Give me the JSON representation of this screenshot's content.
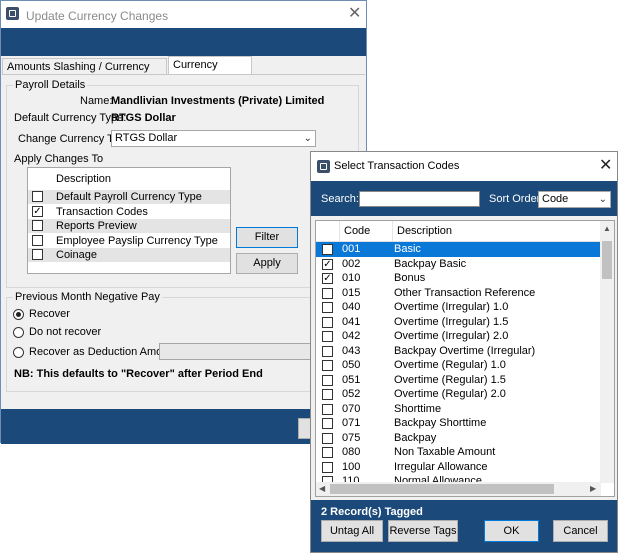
{
  "main_window": {
    "title": "Update Currency Changes",
    "tabs": [
      "Amounts Slashing / Currency Rebasing",
      "Currency Changes"
    ],
    "payroll_details": {
      "group_label": "Payroll Details",
      "name_label": "Name:",
      "name_value": "Mandlivian Investments (Private) Limited",
      "default_currency_label": "Default Currency Type:",
      "default_currency_value": "RTGS Dollar",
      "change_currency_label": "Change Currency To:",
      "change_currency_value": "RTGS Dollar",
      "apply_changes_label": "Apply Changes To",
      "list_header": "Description",
      "items": [
        {
          "label": "Default Payroll Currency Type",
          "checked": false
        },
        {
          "label": "Transaction Codes",
          "checked": true
        },
        {
          "label": "Reports Preview",
          "checked": false
        },
        {
          "label": "Employee Payslip Currency Type",
          "checked": false
        },
        {
          "label": "Coinage",
          "checked": false
        }
      ],
      "filter_button": "Filter",
      "apply_button": "Apply"
    },
    "negative_pay": {
      "group_label": "Previous Month Negative Pay",
      "options": [
        "Recover",
        "Do not recover",
        "Recover as Deduction Amount"
      ],
      "selected": 0,
      "note": "NB: This defaults to \"Recover\" after Period End"
    }
  },
  "dialog": {
    "title": "Select Transaction Codes",
    "search_label": "Search:",
    "search_value": "",
    "sort_label": "Sort Order",
    "sort_value": "Code",
    "columns": [
      "Code",
      "Description"
    ],
    "rows": [
      {
        "code": "001",
        "desc": "Basic",
        "checked": false,
        "selected": true
      },
      {
        "code": "002",
        "desc": "Backpay Basic",
        "checked": true
      },
      {
        "code": "010",
        "desc": "Bonus",
        "checked": true
      },
      {
        "code": "015",
        "desc": "Other Transaction Reference",
        "checked": false
      },
      {
        "code": "040",
        "desc": "Overtime (Irregular) 1.0",
        "checked": false
      },
      {
        "code": "041",
        "desc": "Overtime (Irregular) 1.5",
        "checked": false
      },
      {
        "code": "042",
        "desc": "Overtime (Irregular) 2.0",
        "checked": false
      },
      {
        "code": "043",
        "desc": "Backpay Overtime (Irregular)",
        "checked": false
      },
      {
        "code": "050",
        "desc": "Overtime (Regular) 1.0",
        "checked": false
      },
      {
        "code": "051",
        "desc": "Overtime (Regular) 1.5",
        "checked": false
      },
      {
        "code": "052",
        "desc": "Overtime (Regular) 2.0",
        "checked": false
      },
      {
        "code": "070",
        "desc": "Shorttime",
        "checked": false
      },
      {
        "code": "071",
        "desc": "Backpay Shorttime",
        "checked": false
      },
      {
        "code": "075",
        "desc": "Backpay",
        "checked": false
      },
      {
        "code": "080",
        "desc": "Non Taxable Amount",
        "checked": false
      },
      {
        "code": "100",
        "desc": "Irregular Allowance",
        "checked": false
      },
      {
        "code": "110",
        "desc": "Normal Allowance",
        "checked": false
      }
    ],
    "tagged_status": "2 Record(s) Tagged",
    "buttons": {
      "untag_all": "Untag All",
      "reverse_tags": "Reverse Tags",
      "ok": "OK",
      "cancel": "Cancel"
    }
  },
  "colors": {
    "band": "#1b4a7a",
    "selection": "#0a78d7"
  }
}
